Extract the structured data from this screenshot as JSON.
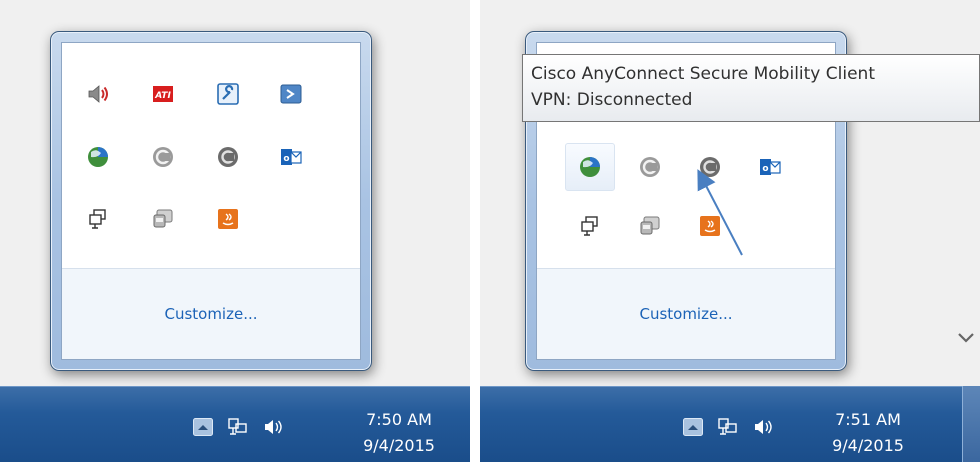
{
  "left_panel": {
    "flyout": {
      "icons": [
        {
          "name": "volume-icon"
        },
        {
          "name": "ati-icon",
          "label": "ATI"
        },
        {
          "name": "tools-icon"
        },
        {
          "name": "powershell-icon"
        },
        {
          "name": "network-globe-icon"
        },
        {
          "name": "sync-icon"
        },
        {
          "name": "cisco-anyconnect-icon"
        },
        {
          "name": "outlook-icon"
        },
        {
          "name": "windows-display-icon"
        },
        {
          "name": "removable-device-icon"
        },
        {
          "name": "java-icon"
        }
      ],
      "customize_label": "Customize..."
    },
    "taskbar": {
      "time": "7:50 AM",
      "date": "9/4/2015"
    }
  },
  "right_panel": {
    "tooltip": {
      "line1": "Cisco AnyConnect Secure Mobility Client",
      "line2": "VPN: Disconnected"
    },
    "flyout": {
      "customize_label": "Customize..."
    },
    "taskbar": {
      "time": "7:51 AM",
      "date": "9/4/2015"
    }
  },
  "colors": {
    "taskbar": "#245a99",
    "customize_link": "#1c63b7",
    "annotation_arrow": "#4a7fc1"
  }
}
